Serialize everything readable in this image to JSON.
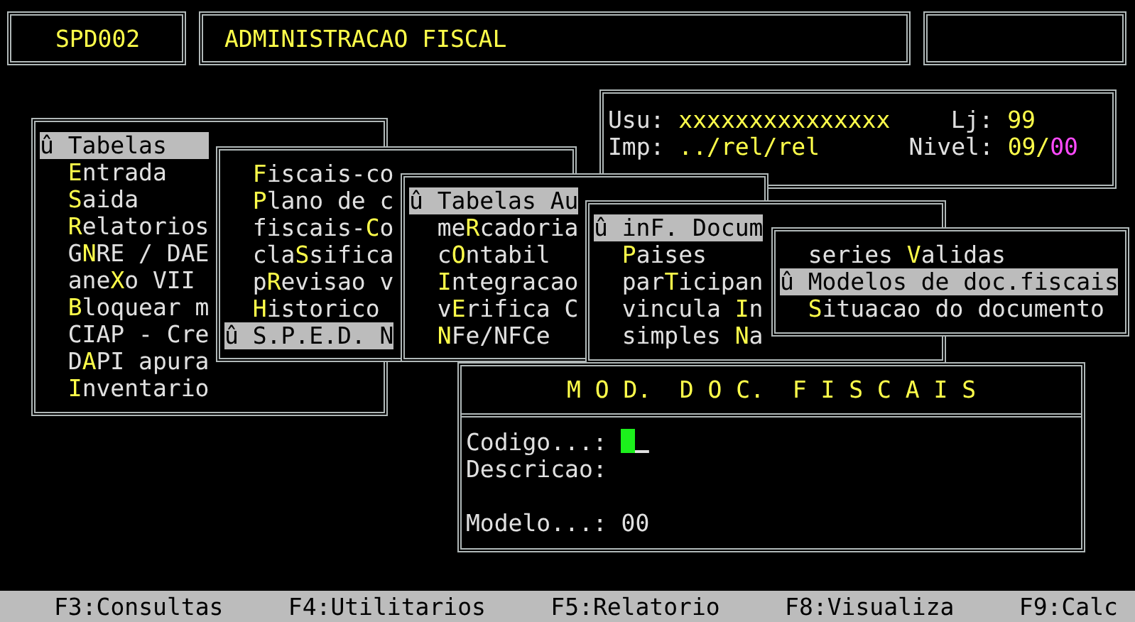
{
  "header": {
    "code": "SPD002",
    "title": "ADMINISTRACAO FISCAL"
  },
  "info": {
    "usu_label": "Usu:",
    "usu": "xxxxxxxxxxxxxxx",
    "lj_label": "Lj:",
    "lj": "99",
    "imp_label": "Imp:",
    "imp": "../rel/rel",
    "nivel_label": "Nivel:",
    "nivel": "09/*00*"
  },
  "menus": [
    {
      "marker": "û",
      "items": [
        {
          "label": "Tabelas",
          "selected": true
        },
        {
          "label": "**E**ntrada",
          "selected": false
        },
        {
          "label": "**S**aida",
          "selected": false
        },
        {
          "label": "**R**elatorios",
          "selected": false
        },
        {
          "label": "G**N**RE / DAE",
          "selected": false
        },
        {
          "label": "ane**X**o VII",
          "selected": false
        },
        {
          "label": "**B**loquear m",
          "selected": false
        },
        {
          "label": "CIAP - Cre",
          "selected": false
        },
        {
          "label": "D**A**PI apura",
          "selected": false
        },
        {
          "label": "**I**nventario",
          "selected": false
        }
      ]
    },
    {
      "marker": "û",
      "items": [
        {
          "label": "**F**iscais-co",
          "selected": false
        },
        {
          "label": "**P**lano de c",
          "selected": false
        },
        {
          "label": "fiscais-**C**o",
          "selected": false
        },
        {
          "label": "cla**S**sifica",
          "selected": false
        },
        {
          "label": "p**R**evisao v",
          "selected": false
        },
        {
          "label": "**H**istorico",
          "selected": false
        },
        {
          "label": "S.P.E.D. N",
          "selected": true
        }
      ]
    },
    {
      "marker": "û",
      "items": [
        {
          "label": "Tabelas Au",
          "selected": true
        },
        {
          "label": "me**R**cadoria",
          "selected": false
        },
        {
          "label": "c**O**ntabil",
          "selected": false
        },
        {
          "label": "**I**ntegracao",
          "selected": false
        },
        {
          "label": "v**E**rifica C",
          "selected": false
        },
        {
          "label": "**N**Fe/NFCe",
          "selected": false
        }
      ]
    },
    {
      "marker": "û",
      "items": [
        {
          "label": "inF. Docum",
          "selected": true
        },
        {
          "label": "**P**aises",
          "selected": false
        },
        {
          "label": "par**T**icipan",
          "selected": false
        },
        {
          "label": "vincula **I**n",
          "selected": false
        },
        {
          "label": "simples **N**a",
          "selected": false
        }
      ]
    },
    {
      "marker": "û",
      "items": [
        {
          "label": "series **V**alidas",
          "selected": false
        },
        {
          "label": "Modelos de doc.fiscais",
          "selected": true
        },
        {
          "label": "**S**ituacao do documento",
          "selected": false
        }
      ]
    }
  ],
  "dialog": {
    "title": "M O D.  D O C.  F I S C A I S",
    "fields": [
      {
        "label": "Codigo...:",
        "kind": "input"
      },
      {
        "label": "Descricao:",
        "kind": "text"
      },
      {
        "label": "Modelo...:",
        "kind": "text",
        "value": "00"
      }
    ]
  },
  "status_bar": [
    "F3:Consultas",
    "F4:Utilitarios",
    "F5:Relatorio",
    "F8:Visualiza",
    "F9:Calc"
  ]
}
